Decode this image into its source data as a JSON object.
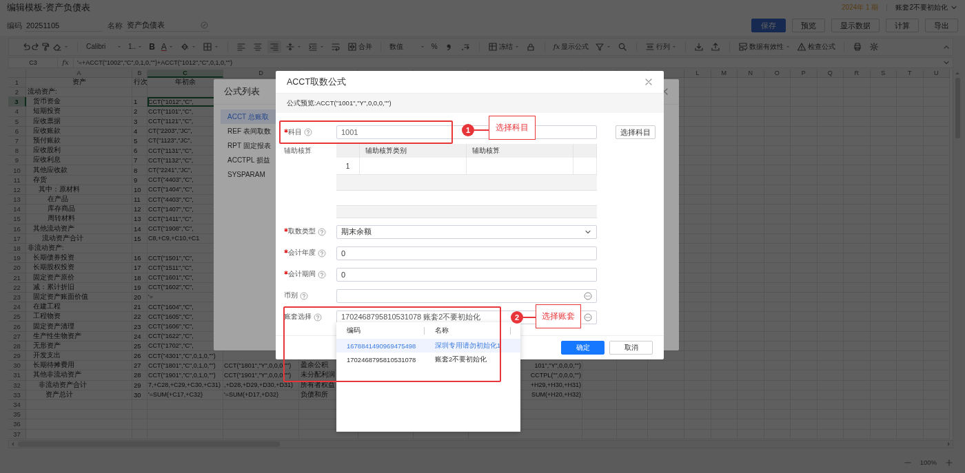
{
  "window": {
    "title": "编辑模板-资产负债表",
    "period": "2024年 1 期",
    "account_set": "账套2不要初始化"
  },
  "header_fields": [
    {
      "label": "编码",
      "value": "20251105"
    },
    {
      "label": "名称",
      "value": "资产负债表"
    }
  ],
  "actions": [
    {
      "label": "保存",
      "primary": true
    },
    {
      "label": "预览",
      "primary": false
    },
    {
      "label": "显示数据",
      "primary": false
    },
    {
      "label": "计算",
      "primary": false
    },
    {
      "label": "导出",
      "primary": false
    }
  ],
  "toolbar": {
    "font": "Calibri",
    "font_size": "1..",
    "bold": "B",
    "font_color": "A",
    "merge": "合并",
    "number_format": "数值",
    "percent": "%",
    "freeze": "冻结",
    "show_formula_mark": "fx",
    "show_formula": "显示公式",
    "rows_cols": "行列",
    "validation": "数据有效性",
    "check_formula": "检查公式"
  },
  "formula_bar": {
    "cell": "C3",
    "fx": "fx",
    "formula": "'=+ACCT(\"1002\",\"C\",0,1,0,\"\")+ACCT(\"1012\",\"C\",0,1,0,\"\")"
  },
  "sheet": {
    "columns_left": [
      {
        "label": "A",
        "selected": false
      },
      {
        "label": "B",
        "selected": false
      },
      {
        "label": "C",
        "selected": true
      },
      {
        "label": "D",
        "selected": false
      }
    ],
    "columns_right": [
      "L",
      "M",
      "N",
      "O",
      "P",
      "Q",
      "R",
      "S",
      "T",
      "U"
    ],
    "rows": [
      {
        "num": "1",
        "a": "资产",
        "b": "行次",
        "c": "年初余",
        "selected": false
      },
      {
        "num": "2",
        "a": "流动资产:",
        "selected": false
      },
      {
        "num": "3",
        "a": "   货币资金",
        "b": "1",
        "c": "CCT(\"1012\",\"C\",",
        "selected": true
      },
      {
        "num": "4",
        "a": "   短期投资",
        "b": "2",
        "c": "CCT(\"1101\",\"C\",",
        "selected": false
      },
      {
        "num": "5",
        "a": "   应收票据",
        "b": "3",
        "c": "CCT(\"1121\",\"C\",",
        "selected": false
      },
      {
        "num": "6",
        "a": "   应收账款",
        "b": "4",
        "c": "CT(\"2203\",\"JC\",",
        "selected": false
      },
      {
        "num": "7",
        "a": "   预付账款",
        "b": "5",
        "c": "CT(\"1123\",\"JC\",",
        "selected": false
      },
      {
        "num": "8",
        "a": "   应收股利",
        "b": "6",
        "c": "CCT(\"1131\",\"C\",",
        "selected": false
      },
      {
        "num": "9",
        "a": "   应收利息",
        "b": "7",
        "c": "CCT(\"1132\",\"C\",",
        "selected": false
      },
      {
        "num": "10",
        "a": "   其他应收款",
        "b": "8",
        "c": "CT(\"2241\",\"JC\",",
        "selected": false
      },
      {
        "num": "11",
        "a": "   存货",
        "b": "9",
        "c": "CCT(\"4403\",\"C\",",
        "selected": false
      },
      {
        "num": "12",
        "a": "      其中：原材料",
        "b": "10",
        "c": "CCT(\"1404\",\"C\",",
        "selected": false
      },
      {
        "num": "13",
        "a": "           在产品",
        "b": "11",
        "c": "CCT(\"4403\",\"C\",",
        "selected": false
      },
      {
        "num": "14",
        "a": "           库存商品",
        "b": "12",
        "c": "CCT(\"1407\",\"C\",",
        "selected": false
      },
      {
        "num": "15",
        "a": "           周转材料",
        "b": "13",
        "c": "CCT(\"1411\",\"C\",",
        "selected": false
      },
      {
        "num": "16",
        "a": "   其他流动资产",
        "b": "14",
        "c": "CCT(\"1908\",\"C\",",
        "selected": false
      },
      {
        "num": "17",
        "a": "        流动资产合计",
        "b": "15",
        "c": "C8,+C9,+C10,+C1",
        "selected": false
      },
      {
        "num": "18",
        "a": "非流动资产:",
        "selected": false
      },
      {
        "num": "19",
        "a": "   长期债券投资",
        "b": "16",
        "c": "CCT(\"1501\",\"C\",",
        "selected": false
      },
      {
        "num": "20",
        "a": "   长期股权投资",
        "b": "17",
        "c": "CCT(\"1511\",\"C\",",
        "selected": false
      },
      {
        "num": "21",
        "a": "   固定资产原价",
        "b": "18",
        "c": "CCT(\"1601\",\"C\",",
        "selected": false
      },
      {
        "num": "22",
        "a": "   减：累计折旧",
        "b": "19",
        "c": "CCT(\"1602\",\"C\",",
        "selected": false
      },
      {
        "num": "23",
        "a": "   固定资产账面价值",
        "b": "20",
        "c": "'=",
        "selected": false
      },
      {
        "num": "24",
        "a": "   在建工程",
        "b": "21",
        "c": "CCT(\"1604\",\"C\",",
        "selected": false
      },
      {
        "num": "25",
        "a": "   工程物资",
        "b": "22",
        "c": "CCT(\"1605\",\"C\",",
        "selected": false
      },
      {
        "num": "26",
        "a": "   固定资产清理",
        "b": "23",
        "c": "CCT(\"1606\",\"C\",",
        "selected": false
      },
      {
        "num": "27",
        "a": "   生产性生物资产",
        "b": "24",
        "c": "CCT(\"1622\",\"C\",",
        "selected": false
      },
      {
        "num": "28",
        "a": "   无形资产",
        "b": "25",
        "c": "CCT(\"1702\",\"C\",",
        "selected": false
      },
      {
        "num": "29",
        "a": "   开发支出",
        "b": "26",
        "c": "CCT(\"4301\",\"C\",0,1,0,\"\")",
        "selected": false
      },
      {
        "num": "30",
        "a": "   长期待摊费用",
        "b": "27",
        "c": "CCT(\"1801\",\"C\",0,1,0,\"\")",
        "d": "CCT(\"1801\",\"Y\",0,0,0,\"\")",
        "e": "盈余公积",
        "h": "101\",\"Y\",0,0,0,\"\")",
        "selected": false
      },
      {
        "num": "31",
        "a": "   其他非流动资产",
        "b": "28",
        "c": "CCT(\"1901\",\"C\",0,1,0,\"\")",
        "d": "CCT(\"1901\",\"Y\",0,0,0,\"\")",
        "e": "未分配利润",
        "h": "CCTPL(\"\",0,0,0,\"\")",
        "selected": false
      },
      {
        "num": "32",
        "a": "      非流动资产合计",
        "b": "29",
        "c": "7,+C28,+C29,+C30,+C31)",
        "d": ",+D28,+D29,+D30,+D31)",
        "e": "所有者权益",
        "h": "+H29,+H30,+H31)",
        "selected": false
      },
      {
        "num": "33",
        "a": "          资产总计",
        "b": "30",
        "c": "'=SUM(+C17,+C32)",
        "d": "'=SUM(+D17,+D32)",
        "e": "负债和所",
        "h": "SUM(+H20,+H32)",
        "selected": false
      },
      {
        "num": "34",
        "selected": false
      },
      {
        "num": "35",
        "selected": false
      },
      {
        "num": "36",
        "selected": false
      },
      {
        "num": "37",
        "selected": false
      }
    ]
  },
  "zoom": "100%",
  "formula_list": {
    "title": "公式列表",
    "items": [
      {
        "label": "ACCT 总账取",
        "selected": true
      },
      {
        "label": "REF 表间取数",
        "selected": false
      },
      {
        "label": "RPT 固定报表",
        "selected": false
      },
      {
        "label": "ACCTPL 损益",
        "selected": false
      },
      {
        "label": "SYSPARAM",
        "selected": false
      }
    ]
  },
  "acct_dialog": {
    "title": "ACCT取数公式",
    "preview": "公式预览:ACCT(\"1001\",\"Y\",0,0,0,\"\")",
    "subject": {
      "label": "科目",
      "required": true,
      "value": "1001",
      "button": "选择科目"
    },
    "aux": {
      "label": "辅助核算",
      "columns": [
        "辅助核算类别",
        "辅助核算"
      ],
      "rows": [
        {
          "num": "1"
        }
      ]
    },
    "fields": [
      {
        "kind": "select",
        "label": "取数类型",
        "required": true,
        "value": "期末余额"
      },
      {
        "kind": "text",
        "label": "会计年度",
        "required": true,
        "value": "0"
      },
      {
        "kind": "text",
        "label": "会计期间",
        "required": true,
        "value": "0"
      },
      {
        "kind": "picker",
        "label": "币别",
        "required": false
      },
      {
        "kind": "picker",
        "label": "账套选择",
        "required": false,
        "value": "1702468795810531078 账套2不要初始化"
      }
    ],
    "dropdown": {
      "columns": [
        "编码",
        "名称"
      ],
      "rows": [
        {
          "code": "1678841490969475498",
          "name": "深圳专用请勿初始化1",
          "selected": true
        },
        {
          "code": "1702468795810531078",
          "name": "账套2不要初始化",
          "selected": false
        }
      ]
    },
    "buttons": [
      {
        "label": "确定",
        "primary": true
      },
      {
        "label": "取消",
        "primary": false
      }
    ],
    "annotations": [
      {
        "number": "1",
        "text": "选择科目"
      },
      {
        "number": "2",
        "text": "选择账套"
      }
    ]
  }
}
